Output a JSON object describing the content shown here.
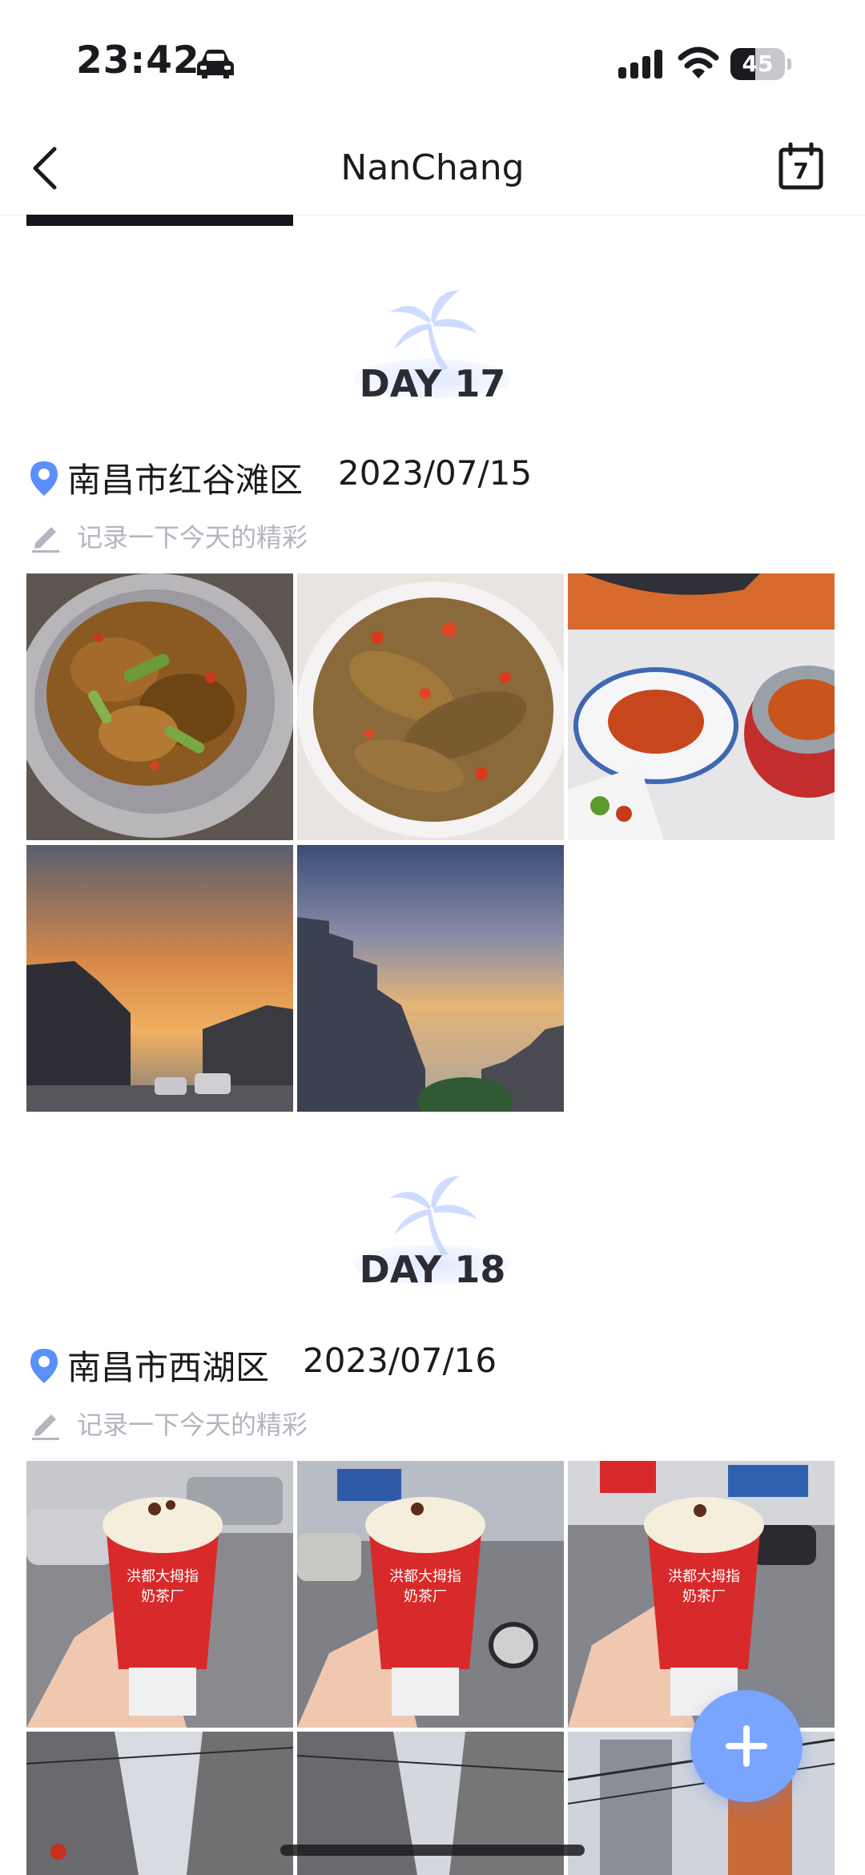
{
  "status_bar": {
    "time": "23:42",
    "battery": "45",
    "battery_level": 0.45,
    "icons": [
      "car-icon",
      "signal-icon",
      "wifi-icon",
      "battery-icon"
    ]
  },
  "header": {
    "title": "NanChang",
    "calendar_badge": "7",
    "icons": [
      "back-chevron-icon",
      "calendar-icon"
    ]
  },
  "days": [
    {
      "label": "DAY 17",
      "location": "南昌市红谷滩区",
      "date": "2023/07/15",
      "note_placeholder": "记录一下今天的精彩",
      "photos": [
        "spicy-chicken-dish",
        "spicy-fish-dish",
        "restaurant-table",
        "sunset-street",
        "sunset-buildings"
      ]
    },
    {
      "label": "DAY 18",
      "location": "南昌市西湖区",
      "date": "2023/07/16",
      "note_placeholder": "记录一下今天的精彩",
      "photos": [
        "milk-tea-street-1",
        "milk-tea-street-2",
        "milk-tea-street-3",
        "alley-view-1",
        "alley-view-2",
        "alley-view-3"
      ],
      "cup_text": [
        "洪都大拇指",
        "奶茶厂"
      ]
    }
  ],
  "fab": {
    "icon": "plus-icon"
  },
  "colors": {
    "accent": "#7aa5ff",
    "pin": "#5b8ff9",
    "note": "#b3b6bf",
    "palm": "#c7d7ff"
  }
}
